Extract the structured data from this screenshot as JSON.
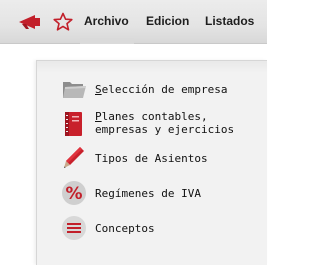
{
  "menubar": {
    "items": [
      {
        "label": "Archivo"
      },
      {
        "label": "Edicion"
      },
      {
        "label": "Listados"
      }
    ],
    "icons": [
      "megaphone-icon",
      "star-icon"
    ],
    "accent": "#c21f2a"
  },
  "dropdown": {
    "items": [
      {
        "accel": "S",
        "rest": "elección de empresa",
        "icon": "folder-icon"
      },
      {
        "accel": "P",
        "rest": "lanes contables,",
        "line2": "empresas y ejercicios",
        "icon": "ledger-book-icon"
      },
      {
        "label": "Tipos de Asientos",
        "icon": "pencil-icon"
      },
      {
        "label": "Regímenes de IVA",
        "icon": "percent-icon"
      },
      {
        "label": "Conceptos",
        "icon": "list-icon"
      }
    ]
  }
}
